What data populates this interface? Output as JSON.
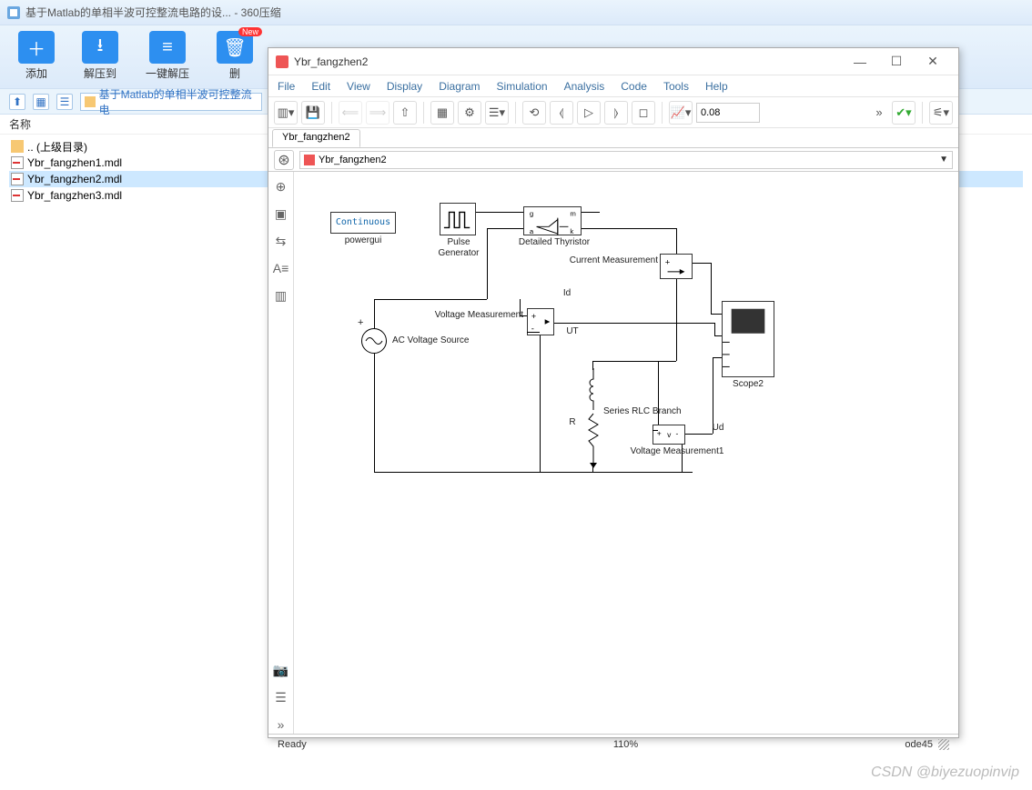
{
  "outer": {
    "title": "基于Matlab的单相半波可控整流电路的设...  - 360压缩",
    "toolbar": [
      {
        "label": "添加",
        "icon": "plus"
      },
      {
        "label": "解压到",
        "icon": "down"
      },
      {
        "label": "一键解压",
        "icon": "flash"
      },
      {
        "label": "删",
        "icon": "del",
        "badge": "New"
      }
    ],
    "subbar": {
      "address": "基于Matlab的单相半波可控整流电"
    },
    "col_head": "名称",
    "files": [
      {
        "name": ".. (上级目录)",
        "type": "fold"
      },
      {
        "name": "Ybr_fangzhen1.mdl",
        "type": "mdl"
      },
      {
        "name": "Ybr_fangzhen2.mdl",
        "type": "mdl",
        "selected": true
      },
      {
        "name": "Ybr_fangzhen3.mdl",
        "type": "mdl"
      }
    ]
  },
  "sim": {
    "title": "Ybr_fangzhen2",
    "menu": [
      "File",
      "Edit",
      "View",
      "Display",
      "Diagram",
      "Simulation",
      "Analysis",
      "Code",
      "Tools",
      "Help"
    ],
    "toolbar": {
      "stop_time": "0.08"
    },
    "tab": "Ybr_fangzhen2",
    "breadcrumb": "Ybr_fangzhen2",
    "status": {
      "left": "Ready",
      "mid": "110%",
      "right": "ode45"
    },
    "blocks": {
      "powergui_text": "Continuous",
      "powergui": "powergui",
      "pulse1": "Pulse",
      "pulse2": "Generator",
      "thyristor": "Detailed Thyristor",
      "current": "Current Measurement",
      "voltage": "Voltage Measurement",
      "voltage1": "Voltage Measurement1",
      "ac": "AC Voltage Source",
      "rlc": "Series RLC Branch",
      "scope": "Scope2",
      "R": "R",
      "UT": "UT",
      "Id": "Id",
      "Ud": "Ud",
      "g": "g",
      "m": "m",
      "a": "a",
      "k": "k"
    }
  },
  "watermark": "CSDN @biyezuopinvip"
}
